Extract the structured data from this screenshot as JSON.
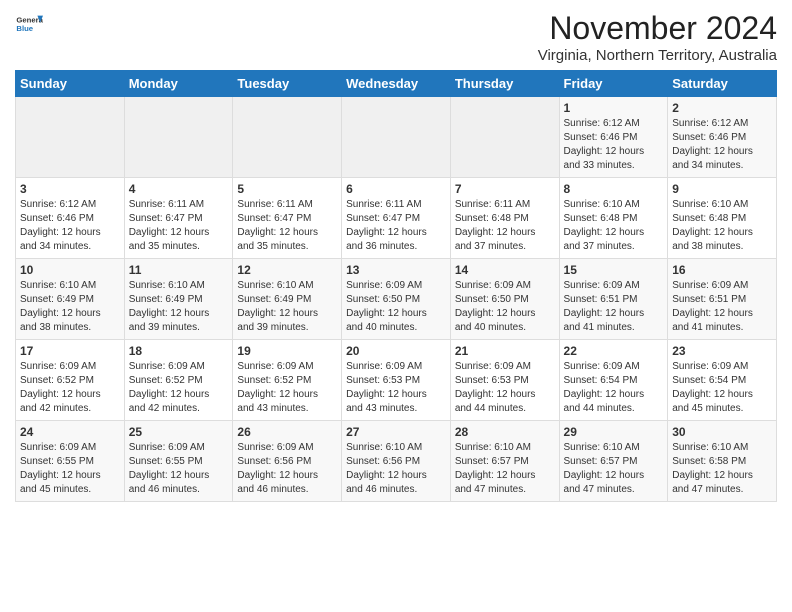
{
  "logo": {
    "general": "General",
    "blue": "Blue"
  },
  "title": "November 2024",
  "subtitle": "Virginia, Northern Territory, Australia",
  "days_header": [
    "Sunday",
    "Monday",
    "Tuesday",
    "Wednesday",
    "Thursday",
    "Friday",
    "Saturday"
  ],
  "weeks": [
    [
      {
        "day": "",
        "info": ""
      },
      {
        "day": "",
        "info": ""
      },
      {
        "day": "",
        "info": ""
      },
      {
        "day": "",
        "info": ""
      },
      {
        "day": "",
        "info": ""
      },
      {
        "day": "1",
        "info": "Sunrise: 6:12 AM\nSunset: 6:46 PM\nDaylight: 12 hours and 33 minutes."
      },
      {
        "day": "2",
        "info": "Sunrise: 6:12 AM\nSunset: 6:46 PM\nDaylight: 12 hours and 34 minutes."
      }
    ],
    [
      {
        "day": "3",
        "info": "Sunrise: 6:12 AM\nSunset: 6:46 PM\nDaylight: 12 hours and 34 minutes."
      },
      {
        "day": "4",
        "info": "Sunrise: 6:11 AM\nSunset: 6:47 PM\nDaylight: 12 hours and 35 minutes."
      },
      {
        "day": "5",
        "info": "Sunrise: 6:11 AM\nSunset: 6:47 PM\nDaylight: 12 hours and 35 minutes."
      },
      {
        "day": "6",
        "info": "Sunrise: 6:11 AM\nSunset: 6:47 PM\nDaylight: 12 hours and 36 minutes."
      },
      {
        "day": "7",
        "info": "Sunrise: 6:11 AM\nSunset: 6:48 PM\nDaylight: 12 hours and 37 minutes."
      },
      {
        "day": "8",
        "info": "Sunrise: 6:10 AM\nSunset: 6:48 PM\nDaylight: 12 hours and 37 minutes."
      },
      {
        "day": "9",
        "info": "Sunrise: 6:10 AM\nSunset: 6:48 PM\nDaylight: 12 hours and 38 minutes."
      }
    ],
    [
      {
        "day": "10",
        "info": "Sunrise: 6:10 AM\nSunset: 6:49 PM\nDaylight: 12 hours and 38 minutes."
      },
      {
        "day": "11",
        "info": "Sunrise: 6:10 AM\nSunset: 6:49 PM\nDaylight: 12 hours and 39 minutes."
      },
      {
        "day": "12",
        "info": "Sunrise: 6:10 AM\nSunset: 6:49 PM\nDaylight: 12 hours and 39 minutes."
      },
      {
        "day": "13",
        "info": "Sunrise: 6:09 AM\nSunset: 6:50 PM\nDaylight: 12 hours and 40 minutes."
      },
      {
        "day": "14",
        "info": "Sunrise: 6:09 AM\nSunset: 6:50 PM\nDaylight: 12 hours and 40 minutes."
      },
      {
        "day": "15",
        "info": "Sunrise: 6:09 AM\nSunset: 6:51 PM\nDaylight: 12 hours and 41 minutes."
      },
      {
        "day": "16",
        "info": "Sunrise: 6:09 AM\nSunset: 6:51 PM\nDaylight: 12 hours and 41 minutes."
      }
    ],
    [
      {
        "day": "17",
        "info": "Sunrise: 6:09 AM\nSunset: 6:52 PM\nDaylight: 12 hours and 42 minutes."
      },
      {
        "day": "18",
        "info": "Sunrise: 6:09 AM\nSunset: 6:52 PM\nDaylight: 12 hours and 42 minutes."
      },
      {
        "day": "19",
        "info": "Sunrise: 6:09 AM\nSunset: 6:52 PM\nDaylight: 12 hours and 43 minutes."
      },
      {
        "day": "20",
        "info": "Sunrise: 6:09 AM\nSunset: 6:53 PM\nDaylight: 12 hours and 43 minutes."
      },
      {
        "day": "21",
        "info": "Sunrise: 6:09 AM\nSunset: 6:53 PM\nDaylight: 12 hours and 44 minutes."
      },
      {
        "day": "22",
        "info": "Sunrise: 6:09 AM\nSunset: 6:54 PM\nDaylight: 12 hours and 44 minutes."
      },
      {
        "day": "23",
        "info": "Sunrise: 6:09 AM\nSunset: 6:54 PM\nDaylight: 12 hours and 45 minutes."
      }
    ],
    [
      {
        "day": "24",
        "info": "Sunrise: 6:09 AM\nSunset: 6:55 PM\nDaylight: 12 hours and 45 minutes."
      },
      {
        "day": "25",
        "info": "Sunrise: 6:09 AM\nSunset: 6:55 PM\nDaylight: 12 hours and 46 minutes."
      },
      {
        "day": "26",
        "info": "Sunrise: 6:09 AM\nSunset: 6:56 PM\nDaylight: 12 hours and 46 minutes."
      },
      {
        "day": "27",
        "info": "Sunrise: 6:10 AM\nSunset: 6:56 PM\nDaylight: 12 hours and 46 minutes."
      },
      {
        "day": "28",
        "info": "Sunrise: 6:10 AM\nSunset: 6:57 PM\nDaylight: 12 hours and 47 minutes."
      },
      {
        "day": "29",
        "info": "Sunrise: 6:10 AM\nSunset: 6:57 PM\nDaylight: 12 hours and 47 minutes."
      },
      {
        "day": "30",
        "info": "Sunrise: 6:10 AM\nSunset: 6:58 PM\nDaylight: 12 hours and 47 minutes."
      }
    ]
  ]
}
